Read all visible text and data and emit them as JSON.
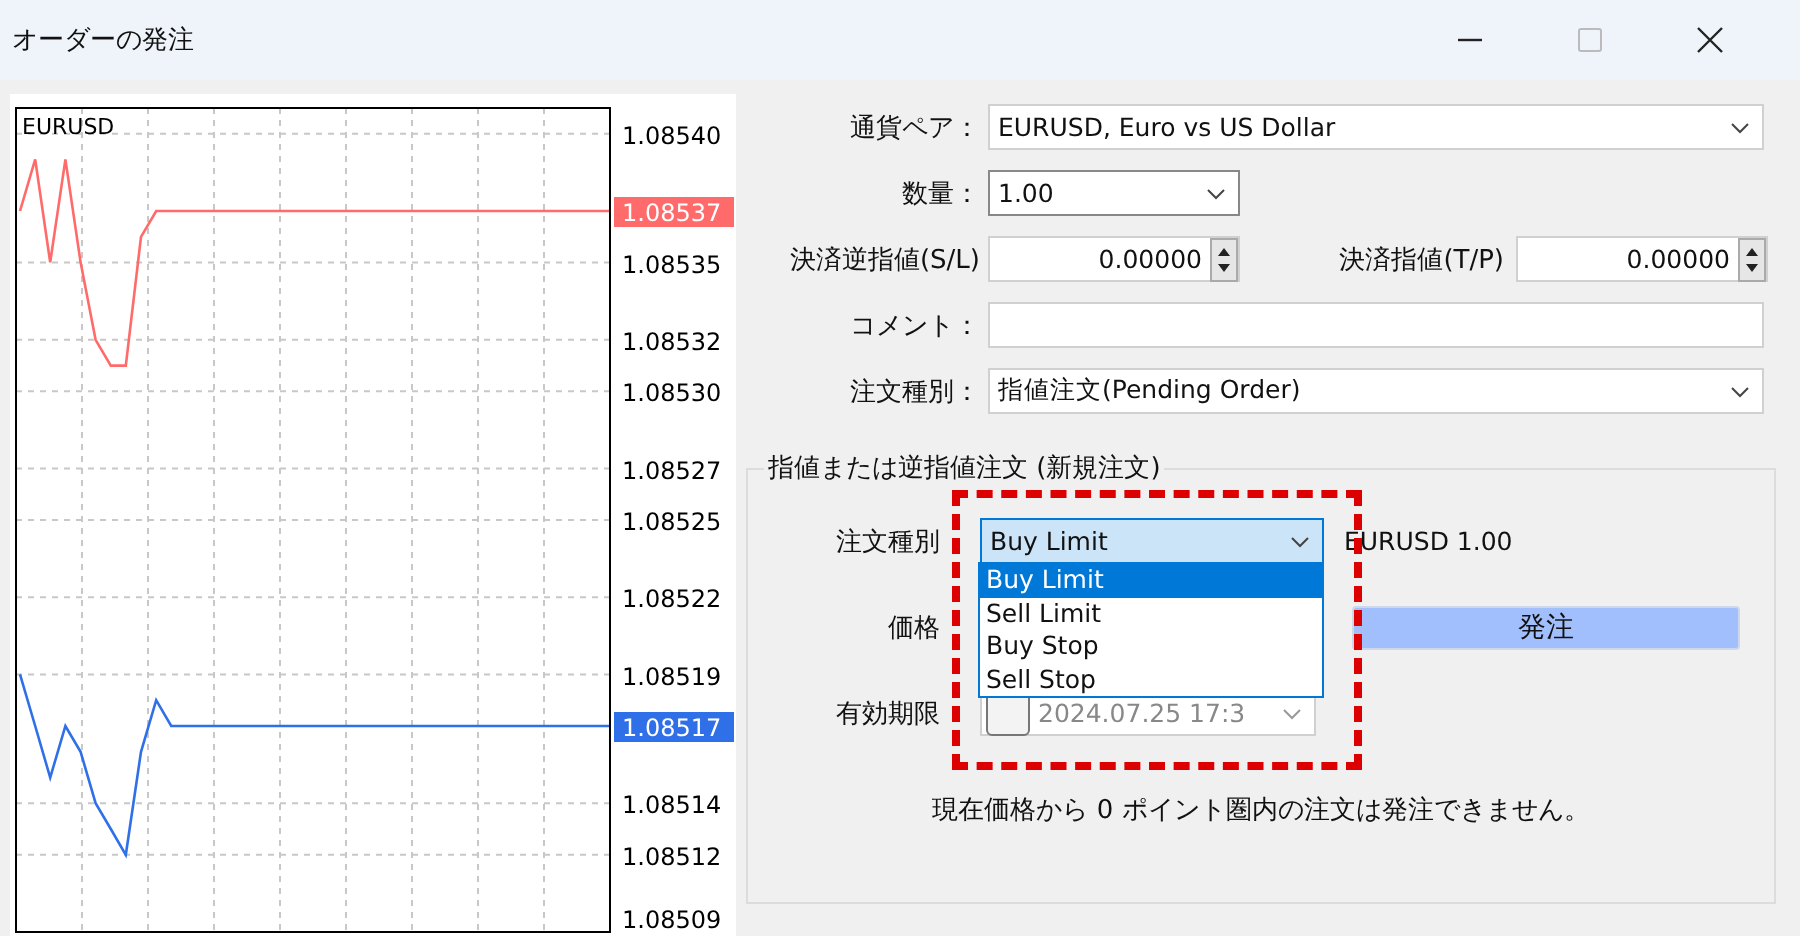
{
  "window": {
    "title": "オーダーの発注",
    "maximize_disabled": true
  },
  "chart": {
    "symbol": "EURUSD",
    "price_tags": [
      "1.08537",
      "1.08517"
    ],
    "chart_data": {
      "type": "line",
      "grid": true,
      "ylim": [
        1.08509,
        1.08541
      ],
      "yticks": [
        {
          "value": 1.0854,
          "label": "1.08540"
        },
        {
          "value": 1.08535,
          "label": "1.08535"
        },
        {
          "value": 1.08532,
          "label": "1.08532"
        },
        {
          "value": 1.0853,
          "label": "1.08530"
        },
        {
          "value": 1.08527,
          "label": "1.08527"
        },
        {
          "value": 1.08525,
          "label": "1.08525"
        },
        {
          "value": 1.08522,
          "label": "1.08522"
        },
        {
          "value": 1.08519,
          "label": "1.08519"
        },
        {
          "value": 1.08514,
          "label": "1.08514"
        },
        {
          "value": 1.08512,
          "label": "1.08512"
        },
        {
          "value": 1.08509,
          "label": "1.08509"
        }
      ],
      "series": [
        {
          "color": "#ff6a6a",
          "values": [
            1.08537,
            1.08539,
            1.08535,
            1.08539,
            1.08535,
            1.08532,
            1.08531,
            1.08531,
            1.08536,
            1.08537,
            1.08537,
            1.08537,
            1.08537,
            1.08537,
            1.08537,
            1.08537,
            1.08537,
            1.08537,
            1.08537,
            1.08537,
            1.08537,
            1.08537,
            1.08537,
            1.08537,
            1.08537,
            1.08537,
            1.08537,
            1.08537,
            1.08537,
            1.08537,
            1.08537,
            1.08537,
            1.08537,
            1.08537,
            1.08537,
            1.08537,
            1.08537,
            1.08537,
            1.08537,
            1.08537
          ]
        },
        {
          "color": "#2f6fe8",
          "values": [
            1.08519,
            1.08517,
            1.08515,
            1.08517,
            1.08516,
            1.08514,
            1.08513,
            1.08512,
            1.08516,
            1.08518,
            1.08517,
            1.08517,
            1.08517,
            1.08517,
            1.08517,
            1.08517,
            1.08517,
            1.08517,
            1.08517,
            1.08517,
            1.08517,
            1.08517,
            1.08517,
            1.08517,
            1.08517,
            1.08517,
            1.08517,
            1.08517,
            1.08517,
            1.08517,
            1.08517,
            1.08517,
            1.08517,
            1.08517,
            1.08517,
            1.08517,
            1.08517,
            1.08517,
            1.08517,
            1.08517
          ]
        }
      ]
    }
  },
  "form": {
    "symbol": {
      "label": "通貨ペア：",
      "value": "EURUSD, Euro vs US Dollar"
    },
    "volume": {
      "label": "数量：",
      "value": "1.00"
    },
    "stop_loss": {
      "label": "決済逆指値(S/L)",
      "value": "0.00000"
    },
    "take_profit": {
      "label": "決済指値(T/P)",
      "value": "0.00000"
    },
    "comment": {
      "label": "コメント："
    },
    "order_type": {
      "label": "注文種別：",
      "value": "指値注文(Pending Order)"
    }
  },
  "pending": {
    "title": "指値または逆指値注文 (新規注文)",
    "type_label": "注文種別",
    "type_value": "Buy Limit",
    "highlighted": true,
    "summary": "EURUSD 1.00",
    "options": [
      {
        "label": "Buy Limit",
        "selected": true
      },
      {
        "label": "Sell Limit",
        "selected": false
      },
      {
        "label": "Buy Stop",
        "selected": false
      },
      {
        "label": "Sell Stop",
        "selected": false
      }
    ],
    "price_label": "価格",
    "place_button": "発注",
    "expiry_label": "有効期限",
    "expiry_checked": false,
    "expiry_value": "2024.07.25 17:3",
    "message": "現在価格から 0 ポイント圏内の注文は発注できません。"
  }
}
